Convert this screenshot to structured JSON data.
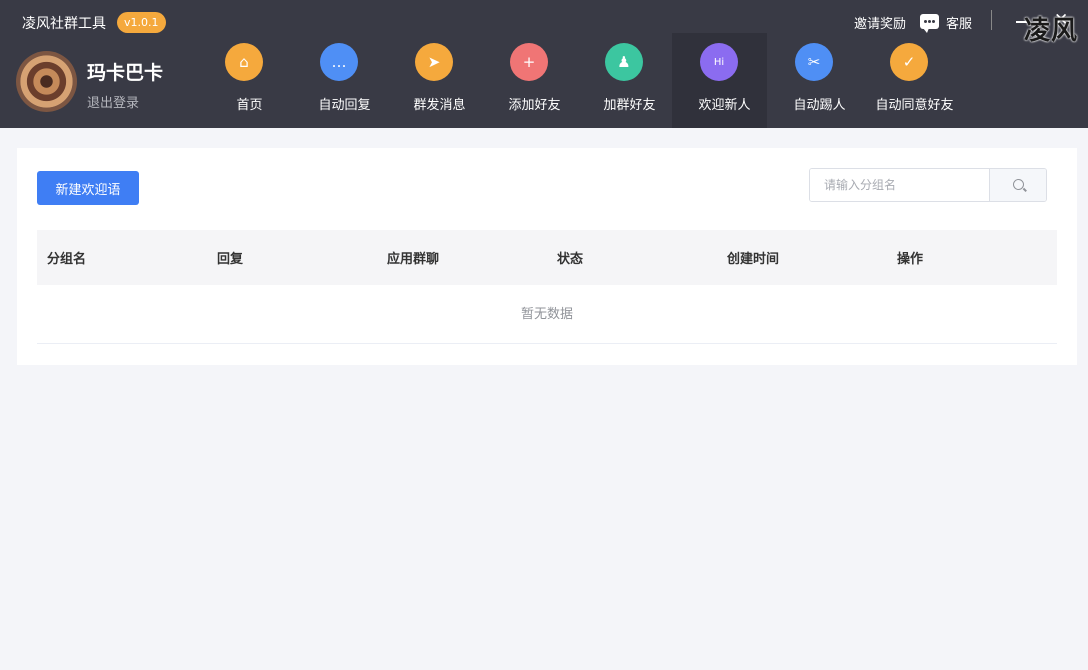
{
  "app": {
    "title": "凌风社群工具",
    "version": "v1.0.1",
    "watermark": "凌风"
  },
  "top_right": {
    "invite_label": "邀请奖励",
    "service_label": "客服",
    "close_glyph": "✕"
  },
  "user": {
    "name": "玛卡巴卡",
    "logout_label": "退出登录"
  },
  "nav": {
    "items": [
      {
        "label": "首页",
        "icon": "home-icon",
        "color": "#f5a93d",
        "glyph": "⌂"
      },
      {
        "label": "自动回复",
        "icon": "chat-icon",
        "color": "#4f8ff5",
        "glyph": "…"
      },
      {
        "label": "群发消息",
        "icon": "send-icon",
        "color": "#f5a93d",
        "glyph": "➤"
      },
      {
        "label": "添加好友",
        "icon": "add-user-icon",
        "color": "#f07575",
        "glyph": "+"
      },
      {
        "label": "加群好友",
        "icon": "group-icon",
        "color": "#3cc6a0",
        "glyph": "♟"
      },
      {
        "label": "欢迎新人",
        "icon": "hi-icon",
        "color": "#8b6cf0",
        "glyph": "Hi"
      },
      {
        "label": "自动踢人",
        "icon": "kick-icon",
        "color": "#4f8ff5",
        "glyph": "✂"
      },
      {
        "label": "自动同意好友",
        "icon": "agree-user-icon",
        "color": "#f5a93d",
        "glyph": "✓"
      }
    ],
    "active_index": 5
  },
  "toolbar": {
    "new_button_label": "新建欢迎语",
    "search_placeholder": "请输入分组名",
    "search_value": ""
  },
  "table": {
    "columns": [
      "分组名",
      "回复",
      "应用群聊",
      "状态",
      "创建时间",
      "操作"
    ],
    "rows": [],
    "empty_text": "暂无数据"
  },
  "colors": {
    "header_bg": "#393a45",
    "accent": "#3f7ef4",
    "badge": "#f5a93d"
  }
}
